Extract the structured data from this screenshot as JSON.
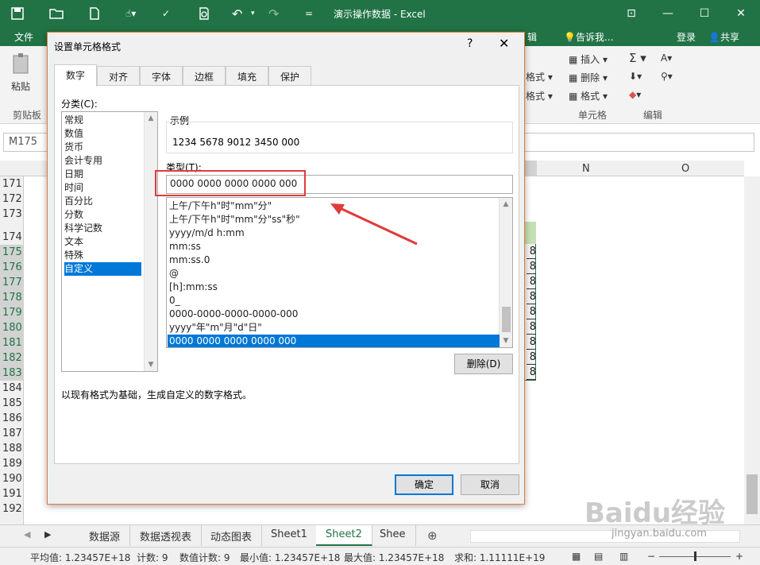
{
  "window": {
    "title": "演示操作数据 - Excel",
    "minimize": "—",
    "restore": "☐",
    "close": "✕",
    "ribbon_display": "⊡"
  },
  "quick_access": {
    "save_icon": "save-icon",
    "undo": "↶",
    "redo": "↷",
    "customize": "="
  },
  "ribbon_tabs": {
    "file": "文件",
    "right_tab": "辑",
    "tell_me": "告诉我...",
    "login": "登录",
    "share": "共享"
  },
  "ribbon": {
    "paste": "粘贴",
    "clipboard_group": "剪贴板",
    "cond_format_partial": "格式 ▾",
    "table_partial": "格式 ▾",
    "insert": "插入 ▾",
    "delete": "删除 ▾",
    "format": "格式 ▾",
    "cells_group": "单元格",
    "edit_group": "编辑",
    "sigma": "Σ ▾",
    "sort": "A▾",
    "fill": "▾",
    "find": "▾",
    "clear": "▾"
  },
  "formula_bar": {
    "name_box": "M175"
  },
  "columns": [
    "N",
    "O"
  ],
  "rows": [
    "171",
    "172",
    "173",
    "174",
    "175",
    "176",
    "177",
    "178",
    "179",
    "180",
    "181",
    "182",
    "183",
    "184",
    "185",
    "186",
    "187",
    "188",
    "189",
    "190",
    "191",
    "192"
  ],
  "selected_rows": [
    "175",
    "176",
    "177",
    "178",
    "179",
    "180",
    "181",
    "182",
    "183"
  ],
  "cell_partial": "8",
  "sheet_tabs": [
    "数据源",
    "数据透视表",
    "动态图表",
    "Sheet1",
    "Sheet2",
    "Shee"
  ],
  "active_sheet": "Sheet2",
  "status": {
    "average": "平均值: 1.23457E+18",
    "count": "计数: 9",
    "numcount": "数值计数: 9",
    "min": "最小值: 1.23457E+18",
    "max": "最大值: 1.23457E+18",
    "sum": "求和: 1.11111E+19"
  },
  "dialog": {
    "title": "设置单元格格式",
    "help": "?",
    "close": "✕",
    "tabs": [
      "数字",
      "对齐",
      "字体",
      "边框",
      "填充",
      "保护"
    ],
    "category_label": "分类(C):",
    "categories": [
      "常规",
      "数值",
      "货币",
      "会计专用",
      "日期",
      "时间",
      "百分比",
      "分数",
      "科学记数",
      "文本",
      "特殊",
      "自定义"
    ],
    "selected_category": "自定义",
    "sample_label": "示例",
    "sample_value": "1234 5678 9012 3450 000",
    "type_label": "类型(T):",
    "type_value": "0000 0000 0000 0000 000",
    "formats": [
      "上午/下午h\"时\"mm\"分\"",
      "上午/下午h\"时\"mm\"分\"ss\"秒\"",
      "yyyy/m/d h:mm",
      "mm:ss",
      "mm:ss.0",
      "@",
      "[h]:mm:ss",
      "0_",
      "0000-0000-0000-0000-000",
      "yyyy\"年\"m\"月\"d\"日\"",
      "0000 0000 0000 0000 000"
    ],
    "selected_format": "0000 0000 0000 0000 000",
    "delete_button": "删除(D)",
    "description": "以现有格式为基础，生成自定义的数字格式。",
    "ok": "确定",
    "cancel": "取消"
  },
  "watermark": "Baidu经验",
  "watermark_url": "jingyan.baidu.com",
  "colors": {
    "excel_green": "#217346",
    "selection": "#0078d7",
    "annotation_red": "#e03b3b"
  }
}
